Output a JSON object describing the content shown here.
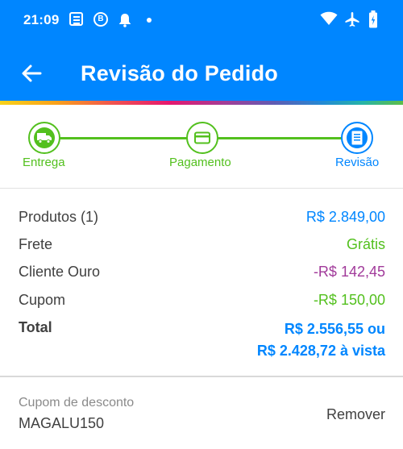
{
  "status_bar": {
    "time": "21:09",
    "icons": [
      "news-icon",
      "b-icon",
      "bell-icon",
      "dot-icon",
      "wifi-icon",
      "airplane-icon",
      "battery-icon"
    ]
  },
  "app_bar": {
    "back_icon": "arrow-left-icon",
    "title": "Revisão do Pedido",
    "color": "#0086ff"
  },
  "stepper": {
    "steps": [
      {
        "label": "Entrega",
        "icon": "truck-icon",
        "state": "done",
        "color": "#53c01e"
      },
      {
        "label": "Pagamento",
        "icon": "card-icon",
        "state": "done",
        "color": "#53c01e"
      },
      {
        "label": "Revisão",
        "icon": "receipt-icon",
        "state": "current",
        "color": "#0086ff"
      }
    ]
  },
  "summary": {
    "products": {
      "label": "Produtos (1)",
      "value": "R$ 2.849,00"
    },
    "shipping": {
      "label": "Frete",
      "value": "Grátis"
    },
    "gold_client": {
      "label": "Cliente Ouro",
      "value": "-R$ 142,45"
    },
    "coupon": {
      "label": "Cupom",
      "value": "-R$ 150,00"
    },
    "total": {
      "label": "Total",
      "value_line1": "R$ 2.556,55 ou",
      "value_line2": "R$ 2.428,72 à vista"
    }
  },
  "coupon_section": {
    "caption": "Cupom de desconto",
    "code": "MAGALU150",
    "remove_label": "Remover"
  }
}
